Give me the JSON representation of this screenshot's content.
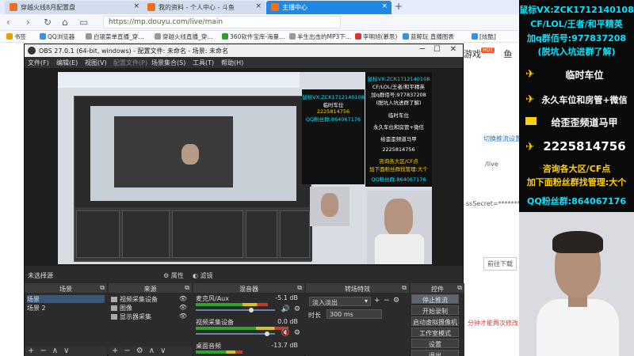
{
  "browser": {
    "tabs": [
      {
        "label": "穿越火线8月配置盘"
      },
      {
        "label": "我的资料 - 个人中心 - 斗鱼"
      },
      {
        "label": "主播中心"
      }
    ],
    "url": "https://mp.douyu.com/live/main",
    "bookmarks": [
      "书签",
      "QQ浏览器",
      "白银菜单直播_穿…",
      "穿越火线直播_穿…",
      "360软件宝库-海量…",
      "半生出击的MP3下…",
      "李明旭(慕思)",
      "蓝鲸玩 直播图表",
      "[炫酷]"
    ]
  },
  "webpage": {
    "nav_game": "游戏",
    "nav_hot": "HOT",
    "nav_fish": "鱼",
    "link_switch": "切换推流设置",
    "live_path": "/live",
    "secret": "ssSecret=**********",
    "download": "前往下载",
    "warn": "分钟才能再次修改"
  },
  "obs": {
    "title": "OBS 27.0.1 (64-bit, windows) - 配置文件: 未命名 - 场景: 未命名",
    "menu": [
      "文件(F)",
      "编辑(E)",
      "视图(V)",
      "配置文件(P)",
      "场景集合(S)",
      "工具(T)",
      "帮助(H)"
    ],
    "no_source": "未选择源",
    "properties_label": "属性",
    "filters_label": "滤镜",
    "docks": {
      "scenes": {
        "title": "场景",
        "items": [
          "场景",
          "场景 2"
        ]
      },
      "sources": {
        "title": "来源",
        "items": [
          "视频采集设备",
          "图像",
          "显示器采集"
        ]
      },
      "mixer": {
        "title": "混音器",
        "tracks": [
          {
            "name": "麦克风/Aux",
            "db": "-5.1 dB",
            "level": 0.7
          },
          {
            "name": "视频采集设备",
            "db": "0.0 dB",
            "level": 0.9
          },
          {
            "name": "桌面音频",
            "db": "-13.7 dB",
            "level": 0.45
          }
        ]
      },
      "transitions": {
        "title": "转场特效",
        "type": "淡入淡出",
        "duration_label": "时长",
        "duration": "300 ms"
      },
      "controls": {
        "title": "控件",
        "buttons": [
          "停止推流",
          "开始录制",
          "启动虚拟摄像机",
          "工作室模式",
          "设置",
          "退出"
        ]
      }
    }
  },
  "preview": {
    "ad_lines": [
      "鼠标VX:ZCK1712140108",
      "CF/LOL/王者/和平精英",
      "加q群佰号:977837208",
      "(脱坑入坑进群了解)",
      "临时车位",
      "永久车位和房管+微信",
      "给歪歪频道马甲",
      "2225814756",
      "咨询各大区/CF点",
      "加下面粉丝群找管理:大个",
      "QQ粉丝群:864067176"
    ]
  },
  "right_ad": {
    "line1": "鼠标VX:ZCK1712140108",
    "line2": "CF/LOL/王者/和平精英",
    "line3": "加q群佰号:977837208",
    "line4": "(脱坑入坑进群了解)",
    "line5": "临时车位",
    "line6": "永久车位和房管+微信",
    "line7": "给歪歪频道马甲",
    "line8": "2225814756",
    "line9": "咨询各大区/CF点",
    "line10": "加下面粉丝群找管理:大个",
    "line11": "QQ粉丝群:864067176",
    "colors": {
      "cyan": "#00e5ff",
      "yellow": "#ffd000",
      "white": "#ffffff"
    }
  }
}
